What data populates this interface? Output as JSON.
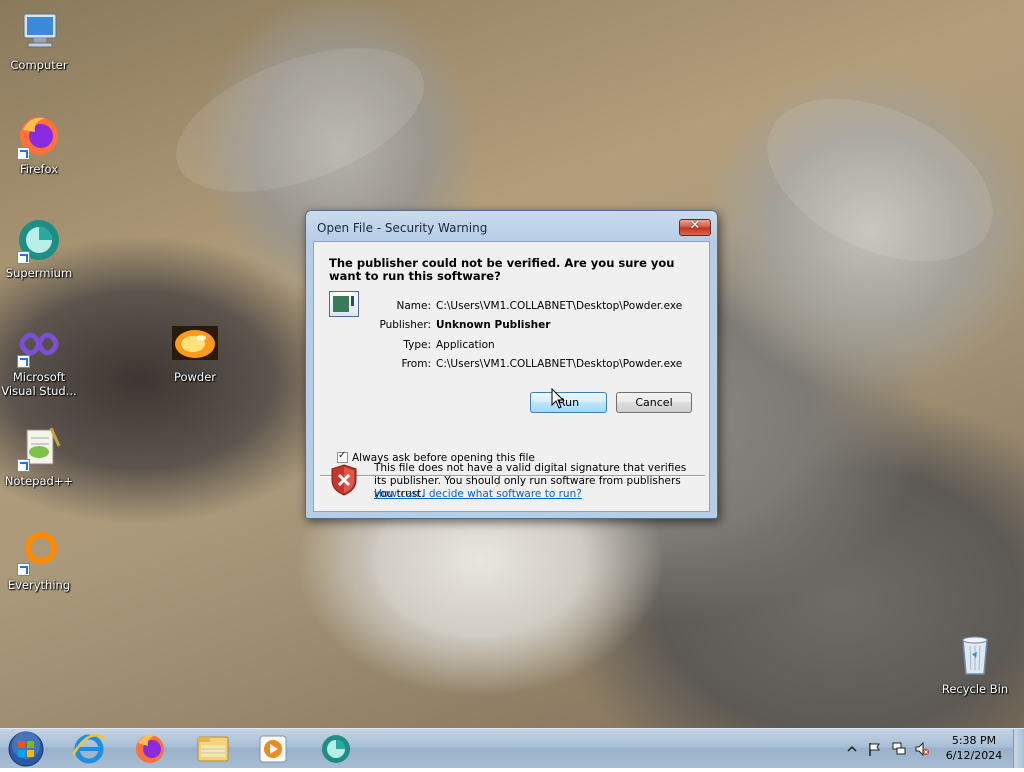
{
  "desktop": {
    "icons": [
      {
        "label": "Computer",
        "icon": "computer-icon",
        "shortcut": false
      },
      {
        "label": "Firefox",
        "icon": "firefox-icon",
        "shortcut": true
      },
      {
        "label": "Supermium",
        "icon": "supermium-icon",
        "shortcut": true
      },
      {
        "label": "Microsoft Visual Stud...",
        "icon": "visual-studio-icon",
        "shortcut": true
      },
      {
        "label": "Notepad++",
        "icon": "notepadpp-icon",
        "shortcut": true
      },
      {
        "label": "Everything",
        "icon": "everything-icon",
        "shortcut": true
      },
      {
        "label": "Powder",
        "icon": "powder-icon",
        "shortcut": false
      },
      {
        "label": "Recycle Bin",
        "icon": "recycle-bin-icon",
        "shortcut": false
      }
    ]
  },
  "dialog": {
    "title": "Open File - Security Warning",
    "close_glyph": "✕",
    "headline": "The publisher could not be verified.  Are you sure you want to run this software?",
    "fields": {
      "name_label": "Name:",
      "name_value": "C:\\Users\\VM1.COLLABNET\\Desktop\\Powder.exe",
      "publisher_label": "Publisher:",
      "publisher_value": "Unknown Publisher",
      "type_label": "Type:",
      "type_value": "Application",
      "from_label": "From:",
      "from_value": "C:\\Users\\VM1.COLLABNET\\Desktop\\Powder.exe"
    },
    "run_label": "Run",
    "cancel_label": "Cancel",
    "checkbox_label": "Always ask before opening this file",
    "checkbox_checked": true,
    "checkbox_mark": "✓",
    "warning_text": "This file does not have a valid digital signature that verifies its publisher.  You should only run software from publishers you trust.",
    "help_link": "How can I decide what software to run?"
  },
  "taskbar": {
    "items": [
      "internet-explorer-icon",
      "firefox-icon",
      "file-explorer-icon",
      "media-player-icon",
      "supermium-icon"
    ],
    "tray": [
      "show-hidden-icons-icon",
      "action-center-flag-icon",
      "network-icon",
      "volume-muted-icon"
    ],
    "time": "5:38 PM",
    "date": "6/12/2024"
  },
  "colors": {
    "link": "#0066cc",
    "taskbar": "#a9bfd6",
    "dialog_frame": "#b7cde6",
    "close_button": "#c1321c"
  }
}
